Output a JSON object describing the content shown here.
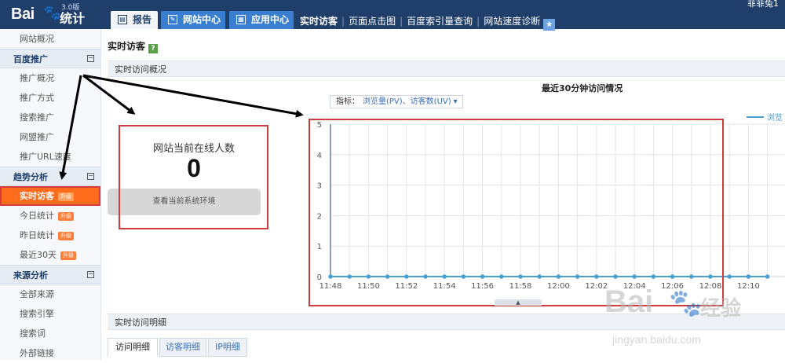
{
  "header": {
    "logo_text": "Bai",
    "logo_product": "统计",
    "logo_version": "3.0版",
    "tabs": [
      {
        "label": "报告",
        "active": true
      },
      {
        "label": "网站中心",
        "active": false
      },
      {
        "label": "应用中心",
        "active": false
      }
    ],
    "links": [
      "实时访客",
      "页面点击图",
      "百度索引量查询",
      "网站速度诊断"
    ],
    "username": "菲菲兔1"
  },
  "sidebar": {
    "items": [
      {
        "type": "item",
        "label": "网站概况"
      },
      {
        "type": "group",
        "label": "百度推广"
      },
      {
        "type": "item",
        "label": "推广概况"
      },
      {
        "type": "item",
        "label": "推广方式"
      },
      {
        "type": "item",
        "label": "搜索推广"
      },
      {
        "type": "item",
        "label": "网盟推广"
      },
      {
        "type": "item",
        "label": "推广URL速度"
      },
      {
        "type": "group",
        "label": "趋势分析"
      },
      {
        "type": "item",
        "label": "实时访客",
        "badge": "升级",
        "active": true
      },
      {
        "type": "item",
        "label": "今日统计",
        "badge": "升级"
      },
      {
        "type": "item",
        "label": "昨日统计",
        "badge": "升级"
      },
      {
        "type": "item",
        "label": "最近30天",
        "badge": "升级"
      },
      {
        "type": "group",
        "label": "来源分析"
      },
      {
        "type": "item",
        "label": "全部来源"
      },
      {
        "type": "item",
        "label": "搜索引擎"
      },
      {
        "type": "item",
        "label": "搜索词"
      },
      {
        "type": "item",
        "label": "外部链接"
      }
    ]
  },
  "main": {
    "page_title": "实时访客",
    "help_icon": "?",
    "overview_section": "实时访问概况",
    "online_label": "网站当前在线人数",
    "online_count": "0",
    "env_button": "查看当前系统环境",
    "metric_label": "指标：",
    "metric_value": "浏览量(PV)、访客数(UV)",
    "detail_section": "实时访问明细",
    "detail_tabs": [
      "访问明细",
      "访客明细",
      "IP明细"
    ]
  },
  "chart_data": {
    "type": "line",
    "title": "最近30分钟访问情况",
    "legend": [
      "浏览"
    ],
    "x": [
      "11:48",
      "11:49",
      "11:50",
      "11:51",
      "11:52",
      "11:53",
      "11:54",
      "11:55",
      "11:56",
      "11:57",
      "11:58",
      "11:59",
      "12:00",
      "12:01",
      "12:02",
      "12:03",
      "12:04",
      "12:05",
      "12:06",
      "12:07",
      "12:08",
      "12:09",
      "12:10",
      "12:11"
    ],
    "x_tick_labels": [
      "11:48",
      "11:50",
      "11:52",
      "11:54",
      "11:56",
      "11:58",
      "12:00",
      "12:02",
      "12:04",
      "12:06",
      "12:08",
      "12:10"
    ],
    "series": [
      {
        "name": "浏览",
        "values": [
          0,
          0,
          0,
          0,
          0,
          0,
          0,
          0,
          0,
          0,
          0,
          0,
          0,
          0,
          0,
          0,
          0,
          0,
          0,
          0,
          0,
          0,
          0,
          0
        ]
      }
    ],
    "ylim": [
      0,
      5
    ],
    "y_ticks": [
      0,
      1,
      2,
      3,
      4,
      5
    ],
    "grid": true,
    "series_color": "#4aa0d0"
  },
  "watermark": {
    "brand": "Bai",
    "product": "经验",
    "url": "jingyan.baidu.com"
  }
}
